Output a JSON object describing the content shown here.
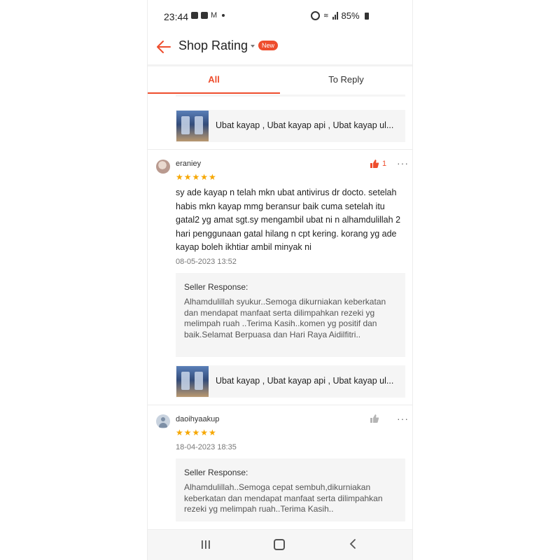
{
  "status_bar": {
    "time": "23:44",
    "battery": "85%"
  },
  "header": {
    "title": "Shop Rating",
    "badge": "New"
  },
  "tabs": [
    {
      "label": "All",
      "active": true
    },
    {
      "label": "To Reply",
      "active": false
    }
  ],
  "colors": {
    "accent": "#ee4d2d",
    "star": "#f6a700"
  },
  "product": {
    "name": "Ubat kayap , Ubat kayap api , Ubat kayap ul..."
  },
  "reviews": [
    {
      "username": "eraniey",
      "likes": "1",
      "rating": 5,
      "stars": "★★★★★",
      "text": "sy ade kayap n telah mkn ubat antivirus dr docto. setelah habis mkn kayap mmg beransur baik cuma setelah itu gatal2 yg amat sgt.sy mengambil ubat ni n alhamdulillah 2 hari penggunaan gatal hilang n cpt kering. korang yg ade kayap boleh ikhtiar ambil  minyak ni",
      "date": "08-05-2023 13:52",
      "seller_response_title": "Seller Response:",
      "seller_response": "Alhamdulillah syukur..Semoga dikurniakan keberkatan dan mendapat manfaat serta dilimpahkan rezeki yg melimpah ruah ..Terima Kasih..komen yg positif dan baik.Selamat Berpuasa dan Hari Raya Aidilfitri..",
      "product_name": "Ubat kayap , Ubat kayap api , Ubat kayap ul..."
    },
    {
      "username": "daoihyaakup",
      "rating": 5,
      "stars": "★★★★★",
      "date": "18-04-2023 18:35",
      "seller_response_title": "Seller Response:",
      "seller_response": "Alhamdulillah..Semoga cepat sembuh,dikurniakan keberkatan dan mendapat manfaat serta dilimpahkan rezeki yg melimpah ruah..Terima Kasih.."
    }
  ],
  "icons": {
    "back": "back-arrow-icon",
    "like": "thumbs-up-icon",
    "more": "more-dots-icon",
    "nav_recent": "recent-apps-icon",
    "nav_home": "home-icon",
    "nav_back": "nav-back-icon"
  }
}
